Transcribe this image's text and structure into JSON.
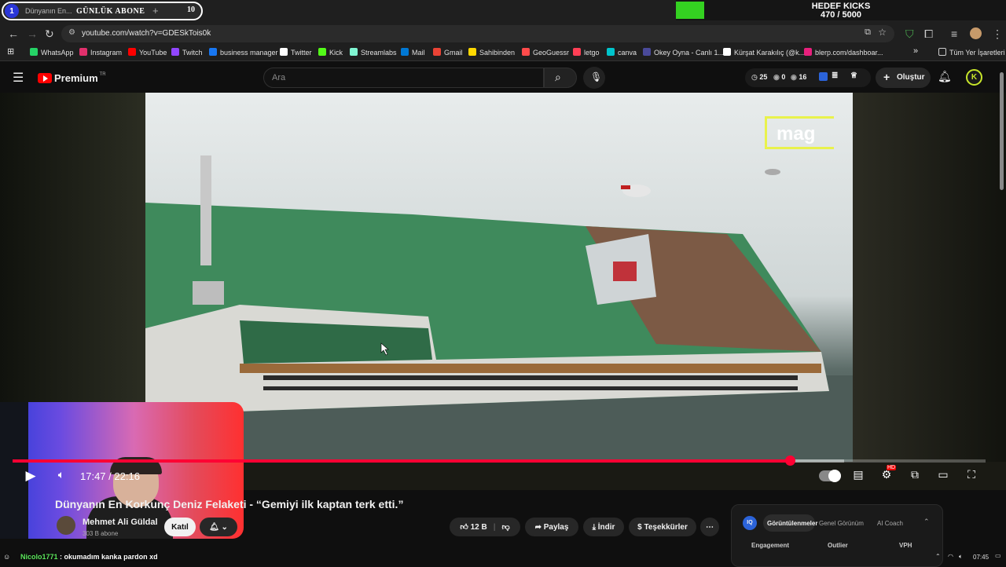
{
  "overlay": {
    "tab_badge_left": "1",
    "tab_title": "Dünyanın En...",
    "banner_text": "GÜNLÜK ABONE",
    "tab_badge_right": "10",
    "goal_title": "HEDEF KICKS",
    "goal_progress": "470 / 5000",
    "goal_fraction": 0.094,
    "chat_user": "Nicolo1771",
    "chat_message": ": okumadım kanka pardon xd"
  },
  "browser": {
    "url": "youtube.com/watch?v=GDESkTois0k",
    "bookmarks": [
      "WhatsApp",
      "Instagram",
      "YouTube",
      "Twitch",
      "business manager",
      "Twitter",
      "Kick",
      "Streamlabs",
      "Mail",
      "Gmail",
      "Sahibinden",
      "GeoGuessr",
      "letgo",
      "canva",
      "Okey Oyna - Canlı 1...",
      "Kürşat Karakılıç (@k...",
      "blerp.com/dashboar..."
    ],
    "bookmark_colors": [
      "#25d366",
      "#e1306c",
      "#ff0000",
      "#9146ff",
      "#1877f2",
      "#ffffff",
      "#53fc18",
      "#80f5d2",
      "#0078d4",
      "#ea4335",
      "#ffd800",
      "#ff4b4b",
      "#ff3f55",
      "#00c4cc",
      "#4a4a9a",
      "#ffffff",
      "#e8207d"
    ],
    "all_bookmarks": "Tüm Yer İşaretleri"
  },
  "youtube": {
    "logo_text": "Premium",
    "logo_sup": "TR",
    "search_placeholder": "Ara",
    "stat_a": "25",
    "stat_b": "0",
    "stat_c": "16",
    "create_label": "Oluştur",
    "avatar_letter": "K"
  },
  "player": {
    "watermark": "mag",
    "current_time": "17:47",
    "separator": "/",
    "duration": "22:16",
    "played_fraction": 0.799,
    "buffered_fraction": 0.855,
    "hd_badge": "HD"
  },
  "video": {
    "title": "Dünyanın En Korkunç Deniz Felaketi - “Gemiyi ilk kaptan terk etti.”",
    "channel_name": "Mehmet Ali Güldal",
    "subscribers": "303 B abone",
    "join_label": "Katıl",
    "likes": "12 B",
    "share_label": "Paylaş",
    "download_label": "İndir",
    "thanks_label": "Teşekkürler"
  },
  "extension_panel": {
    "badge": "IQ",
    "tabs": [
      "Görüntülenmeler",
      "Genel Görünüm",
      "AI Coach"
    ],
    "columns": [
      "Engagement",
      "Outlier",
      "VPH"
    ]
  },
  "taskbar": {
    "clock": "07:45"
  }
}
